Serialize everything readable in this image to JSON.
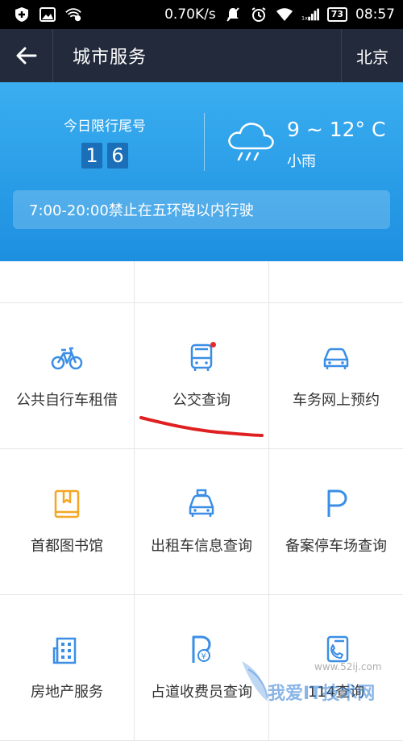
{
  "status_bar": {
    "speed": "0.70K/s",
    "battery": "73",
    "time": "08:57"
  },
  "header": {
    "title": "城市服务",
    "city": "北京"
  },
  "banner": {
    "limit_label": "今日限行尾号",
    "digits": [
      "1",
      "6"
    ],
    "temperature": "9 ~ 12° C",
    "condition": "小雨",
    "notice": "7:00-20:00禁止在五环路以内行驶"
  },
  "services": [
    {
      "label": "公共自行车租借",
      "icon": "bicycle-icon"
    },
    {
      "label": "公交查询",
      "icon": "bus-icon",
      "badge": true
    },
    {
      "label": "车务网上预约",
      "icon": "car-icon"
    },
    {
      "label": "首都图书馆",
      "icon": "book-icon"
    },
    {
      "label": "出租车信息查询",
      "icon": "taxi-icon"
    },
    {
      "label": "备案停车场查询",
      "icon": "parking-icon"
    },
    {
      "label": "房地产服务",
      "icon": "building-icon"
    },
    {
      "label": "占道收费员查询",
      "icon": "parking-fee-icon"
    },
    {
      "label": "114查询",
      "icon": "phone-icon"
    }
  ],
  "watermark": {
    "text": "我爱IT技术网",
    "url": "www.52ij.com"
  },
  "colors": {
    "header_bg": "#222a3b",
    "banner_blue": "#2a9be8",
    "icon_blue": "#3a8ee6",
    "icon_orange": "#f5a623",
    "annotation_red": "#e02020"
  }
}
